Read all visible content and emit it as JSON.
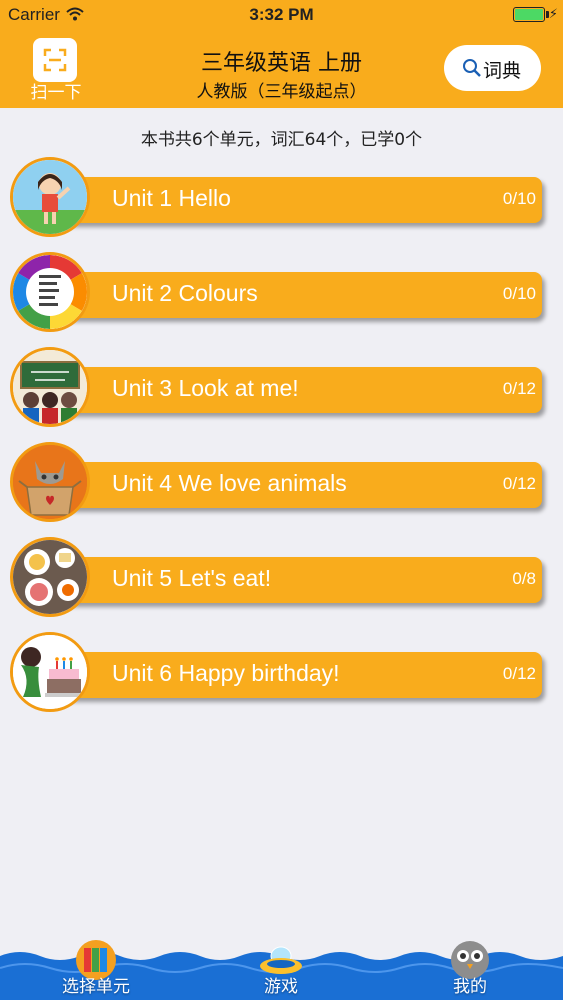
{
  "status_bar": {
    "carrier": "Carrier",
    "time": "3:32 PM"
  },
  "header": {
    "scan_label": "扫一下",
    "title": "三年级英语 上册",
    "subtitle": "人教版（三年级起点）",
    "dict_label": "词典"
  },
  "summary": "本书共6个单元，词汇64个，已学0个",
  "units": [
    {
      "title": "Unit 1 Hello",
      "progress": "0/10"
    },
    {
      "title": "Unit 2 Colours",
      "progress": "0/10"
    },
    {
      "title": "Unit 3 Look at me!",
      "progress": "0/12"
    },
    {
      "title": "Unit 4 We love animals",
      "progress": "0/12"
    },
    {
      "title": "Unit 5 Let's eat!",
      "progress": "0/8"
    },
    {
      "title": "Unit 6 Happy birthday!",
      "progress": "0/12"
    }
  ],
  "tabs": [
    {
      "label": "选择单元",
      "icon": "books-icon"
    },
    {
      "label": "游戏",
      "icon": "ufo-icon"
    },
    {
      "label": "我的",
      "icon": "owl-icon"
    }
  ],
  "colors": {
    "accent": "#f9ac1c",
    "background": "#efeff4",
    "tabbar": "#1a6fd4"
  }
}
